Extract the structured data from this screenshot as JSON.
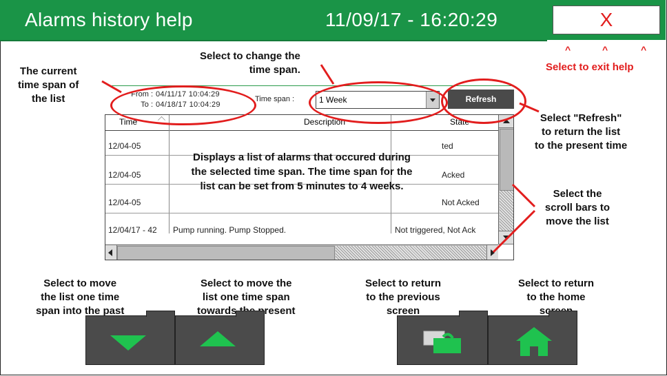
{
  "header": {
    "title": "Alarms history help",
    "datetime": "11/09/17 - 16:20:29",
    "exit_label": "X"
  },
  "carets": [
    "^",
    "^",
    "^"
  ],
  "annotations": {
    "current_time_span": [
      "The current",
      "time span of",
      "the list"
    ],
    "change_time_span": [
      "Select to change the",
      "time span."
    ],
    "exit_help": "Select to exit help",
    "refresh": [
      "Select \"Refresh\"",
      "to return the list",
      "to the present time"
    ],
    "scroll_bars": [
      "Select the",
      "scroll bars to",
      "move the list"
    ],
    "move_past": [
      "Select to move",
      "the list one time",
      "span into the past"
    ],
    "move_present": [
      "Select to move the",
      "list one time span",
      "towards the present"
    ],
    "previous_screen": [
      "Select to return",
      "to the previous",
      "screen"
    ],
    "home_screen": [
      "Select to return",
      "to the home",
      "screen"
    ],
    "list_description": [
      "Displays a list of alarms that occured during",
      "the selected time span. The time span for the",
      "list can be set from 5 minutes to 4 weeks."
    ]
  },
  "panel": {
    "from_label": "From :",
    "from_value": "04/11/17   10:04:29",
    "to_label": "To :",
    "to_value": "04/18/17   10:04:29",
    "time_span_label": "Time span :",
    "time_span_value": "1 Week",
    "refresh_label": "Refresh"
  },
  "list": {
    "columns": [
      "Time",
      "Description",
      "State"
    ],
    "rows": [
      {
        "time": "12/04-05",
        "description": "",
        "state": "ted"
      },
      {
        "time": "12/04-05",
        "description": "",
        "state": "Acked"
      },
      {
        "time": "12/04-05",
        "description": "",
        "state": "Not Acked"
      },
      {
        "time": "12/04/17 - 42",
        "description": "Pump running. Pump Stopped.",
        "state": "Not triggered, Not Ack"
      }
    ]
  },
  "colors": {
    "header_green": "#1a9447",
    "annotation_red": "#e21d1d",
    "button_gray": "#4b4b4b",
    "icon_green": "#1fc24f"
  },
  "icons": {
    "down": "arrow-down-icon",
    "up": "arrow-up-icon",
    "previous": "previous-screen-icon",
    "home": "home-icon"
  }
}
